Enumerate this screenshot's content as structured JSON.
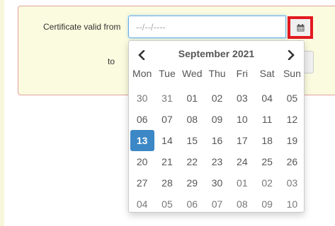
{
  "form": {
    "from_label": "Certificate valid from",
    "to_label": "to",
    "date_placeholder": "--/--/----"
  },
  "picker": {
    "month_title": "September 2021",
    "prev_icon": "chevron-left-icon",
    "next_icon": "chevron-right-icon",
    "weekdays": [
      "Mon",
      "Tue",
      "Wed",
      "Thu",
      "Fri",
      "Sat",
      "Sun"
    ],
    "weeks": [
      [
        {
          "d": "30",
          "m": true
        },
        {
          "d": "31",
          "m": true
        },
        {
          "d": "01"
        },
        {
          "d": "02"
        },
        {
          "d": "03"
        },
        {
          "d": "04"
        },
        {
          "d": "05"
        }
      ],
      [
        {
          "d": "06"
        },
        {
          "d": "07"
        },
        {
          "d": "08"
        },
        {
          "d": "09"
        },
        {
          "d": "10"
        },
        {
          "d": "11"
        },
        {
          "d": "12"
        }
      ],
      [
        {
          "d": "13",
          "a": true
        },
        {
          "d": "14"
        },
        {
          "d": "15"
        },
        {
          "d": "16"
        },
        {
          "d": "17"
        },
        {
          "d": "18"
        },
        {
          "d": "19"
        }
      ],
      [
        {
          "d": "20"
        },
        {
          "d": "21"
        },
        {
          "d": "22"
        },
        {
          "d": "23"
        },
        {
          "d": "24"
        },
        {
          "d": "25"
        },
        {
          "d": "26"
        }
      ],
      [
        {
          "d": "27"
        },
        {
          "d": "28"
        },
        {
          "d": "29"
        },
        {
          "d": "30"
        },
        {
          "d": "01",
          "m": true
        },
        {
          "d": "02",
          "m": true
        },
        {
          "d": "03",
          "m": true
        }
      ],
      [
        {
          "d": "04",
          "m": true
        },
        {
          "d": "05",
          "m": true
        },
        {
          "d": "06",
          "m": true
        },
        {
          "d": "07",
          "m": true
        },
        {
          "d": "08",
          "m": true
        },
        {
          "d": "09",
          "m": true
        },
        {
          "d": "10",
          "m": true
        }
      ]
    ],
    "selected_day": "13"
  },
  "colors": {
    "panel_bg": "#fbfbdf",
    "panel_border": "#e4a0a0",
    "highlight_border": "#e3191f",
    "active_day_bg": "#3c87c6",
    "focus_border": "#66afe9"
  },
  "icons": {
    "calendar": "calendar-icon"
  }
}
